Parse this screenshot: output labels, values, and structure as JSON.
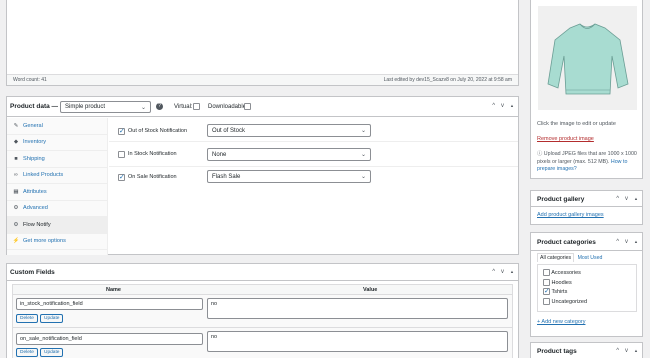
{
  "editor": {
    "word_count": "Word count: 41",
    "last_edited": "Last edited by dev15_Scazv8 on July 20, 2022 at 9:58 am"
  },
  "product_data": {
    "title": "Product data —",
    "type_select": "Simple product",
    "virtual_label": "Virtual:",
    "downloadable_label": "Downloadable:",
    "tabs": [
      {
        "label": "General",
        "icon": "wrench-icon"
      },
      {
        "label": "Inventory",
        "icon": "tag-icon"
      },
      {
        "label": "Shipping",
        "icon": "truck-icon"
      },
      {
        "label": "Linked Products",
        "icon": "link-icon"
      },
      {
        "label": "Attributes",
        "icon": "table-icon"
      },
      {
        "label": "Advanced",
        "icon": "gear-icon"
      },
      {
        "label": "Flow Notify",
        "icon": "gear-icon"
      },
      {
        "label": "Get more options",
        "icon": "plugin-icon"
      }
    ],
    "notify_rows": [
      {
        "label": "Out of Stock Notification",
        "checked": true,
        "value": "Out of Stock"
      },
      {
        "label": "In Stock Notification",
        "checked": false,
        "value": "None"
      },
      {
        "label": "On Sale Notification",
        "checked": true,
        "value": "Flash Sale"
      }
    ]
  },
  "custom_fields": {
    "title": "Custom Fields",
    "col_name": "Name",
    "col_value": "Value",
    "rows": [
      {
        "name": "in_stock_notification_field",
        "value": "no"
      },
      {
        "name": "on_sale_notification_field",
        "value": "no"
      }
    ],
    "delete_label": "Delete",
    "update_label": "Update"
  },
  "product_image": {
    "hint": "Click the image to edit or update",
    "remove_link": "Remove product image",
    "upload_text": "Upload JPEG files that are 1000 x 1000 pixels or larger (max. 512 MB).",
    "how_link": "How to prepare images?"
  },
  "product_gallery": {
    "title": "Product gallery",
    "add_link": "Add product gallery images"
  },
  "product_categories": {
    "title": "Product categories",
    "tab_all": "All categories",
    "tab_most_used": "Most Used",
    "items": [
      {
        "label": "Accessories",
        "checked": false
      },
      {
        "label": "Hoodies",
        "checked": false
      },
      {
        "label": "Tshirts",
        "checked": true
      },
      {
        "label": "Uncategorized",
        "checked": false
      }
    ],
    "add_link": "+ Add new category"
  },
  "product_tags": {
    "title": "Product tags"
  },
  "arrows": {
    "up": "^",
    "down": "v",
    "toggle": "▲"
  },
  "colors": {
    "accent": "#2271b1",
    "danger": "#b32d2e",
    "sweater": "#a8dcd1"
  }
}
